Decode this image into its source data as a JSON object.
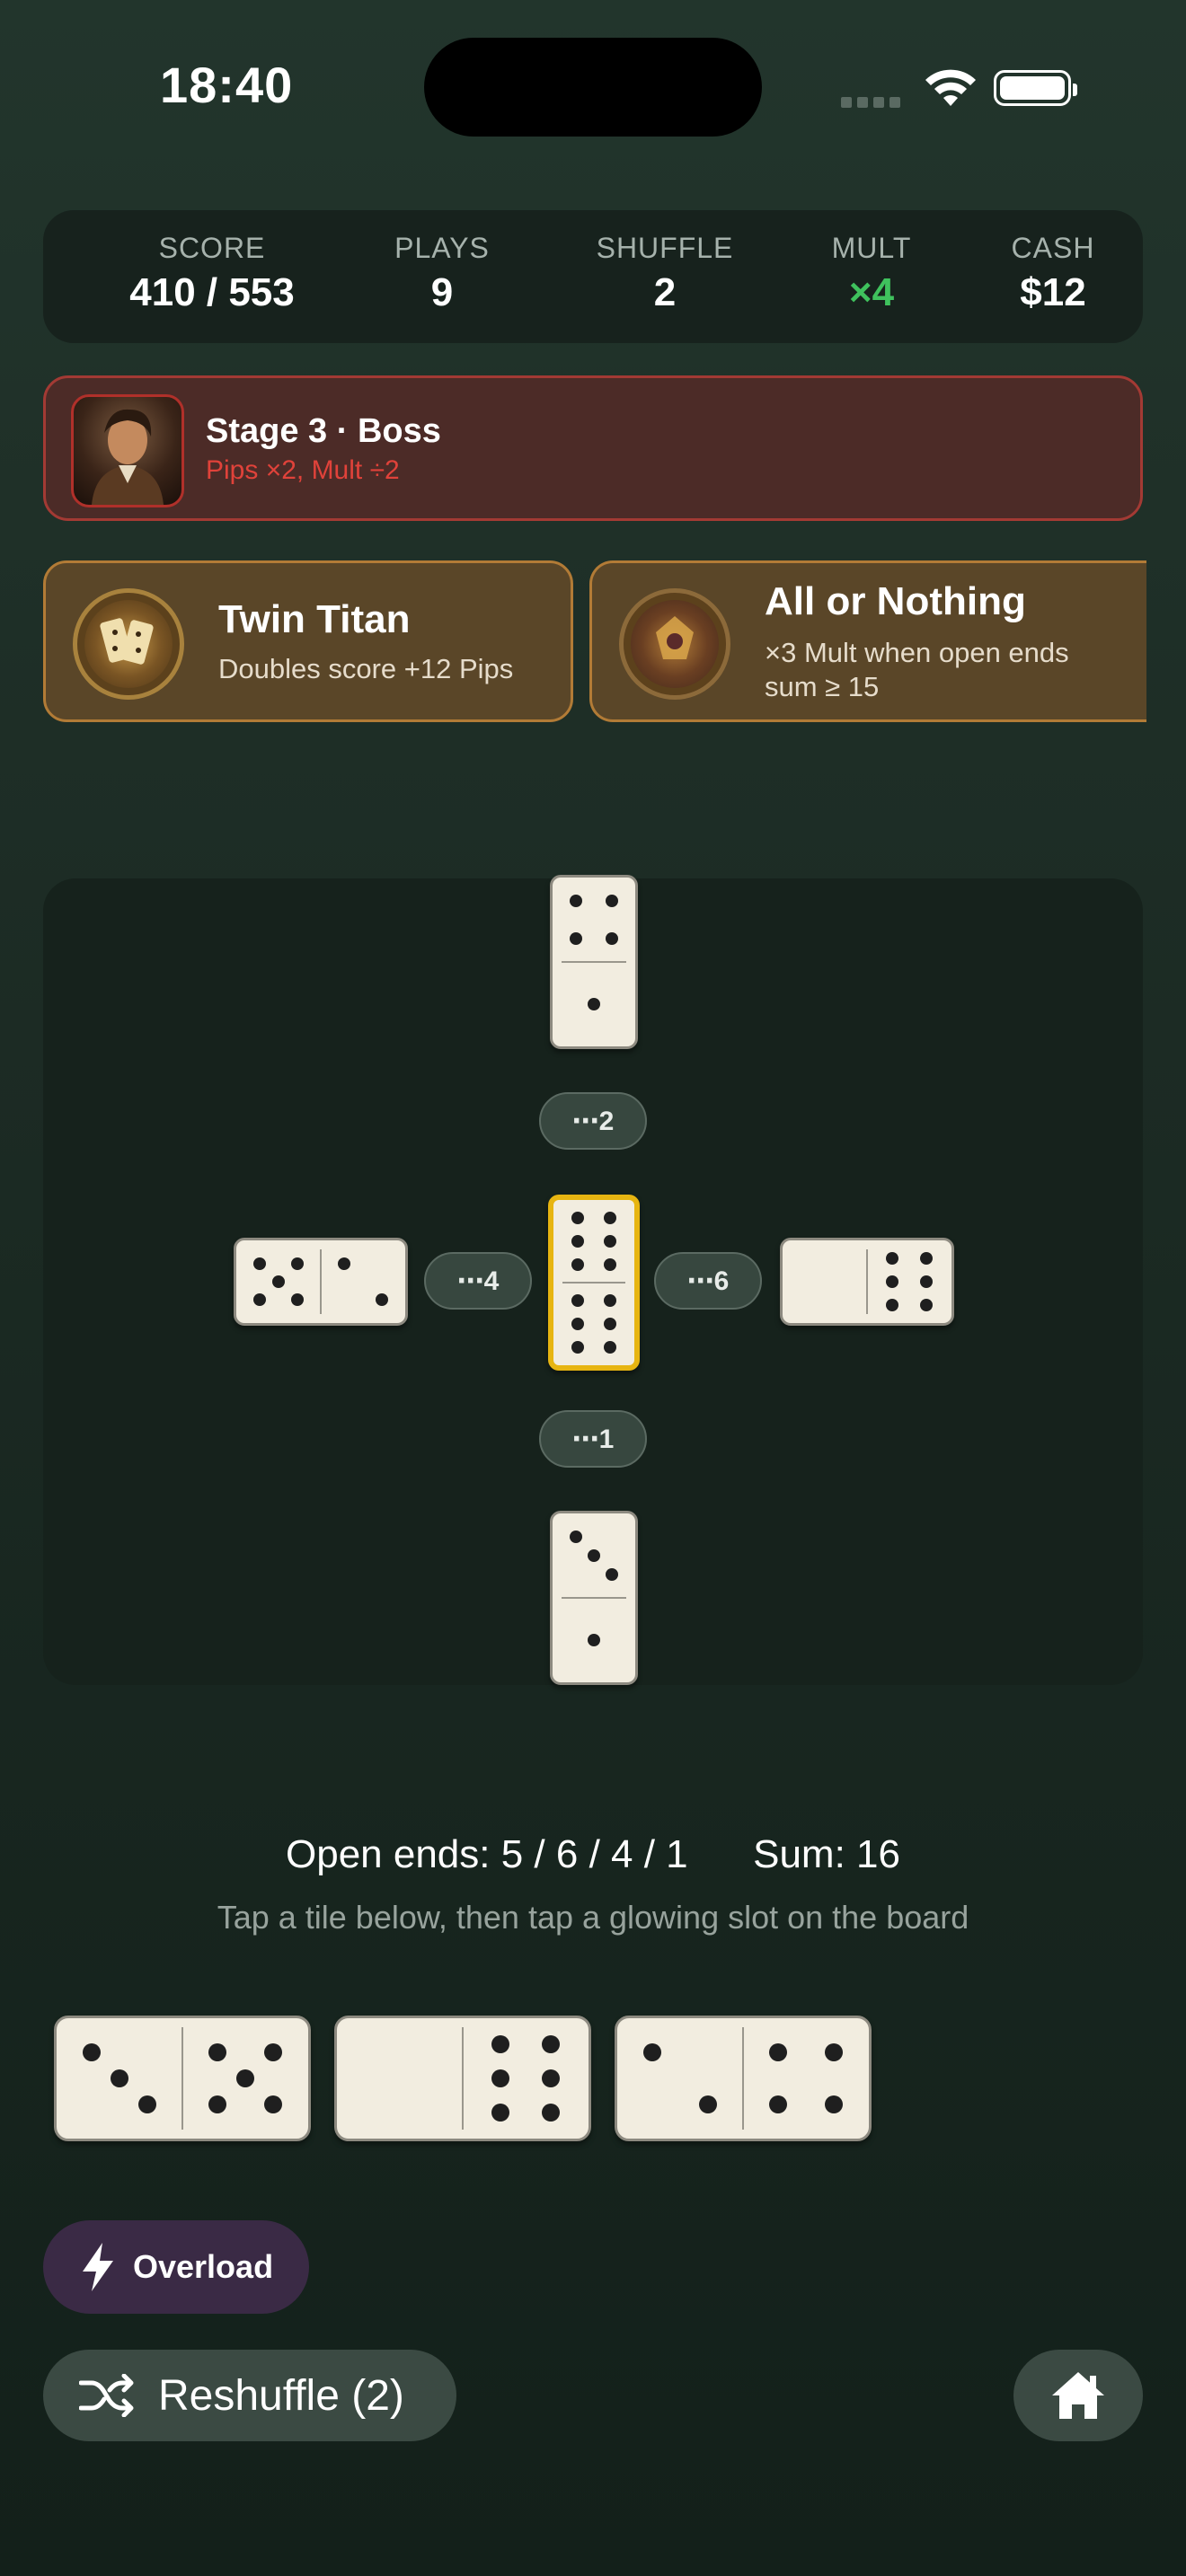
{
  "status_bar": {
    "time": "18:40"
  },
  "stats": [
    {
      "label": "SCORE",
      "value": "410 / 553"
    },
    {
      "label": "PLAYS",
      "value": "9"
    },
    {
      "label": "SHUFFLE",
      "value": "2"
    },
    {
      "label": "MULT",
      "value": "×4"
    },
    {
      "label": "CASH",
      "value": "$12"
    }
  ],
  "boss": {
    "title": "Stage 3 · Boss",
    "effect": "Pips ×2, Mult ÷2"
  },
  "jokers": [
    {
      "name": "Twin Titan",
      "desc_line1": "Doubles score +12 Pips",
      "desc_line2": ""
    },
    {
      "name": "All or Nothing",
      "desc_line1": "×3 Mult when open ends",
      "desc_line2": "sum ≥ 15"
    }
  ],
  "board": {
    "slots": {
      "top": "⋯2",
      "left": "⋯4",
      "right": "⋯6",
      "bottom": "⋯1"
    },
    "tiles": {
      "top": [
        4,
        1
      ],
      "center": [
        6,
        6
      ],
      "left": [
        5,
        2
      ],
      "right": [
        0,
        6
      ],
      "bottom": [
        3,
        1
      ]
    }
  },
  "info": {
    "open_ends": "Open ends: 5 / 6 / 4 / 1",
    "sum": "Sum: 16",
    "hint": "Tap a tile below, then tap a glowing slot on the board"
  },
  "hand": [
    [
      3,
      5
    ],
    [
      0,
      6
    ],
    [
      2,
      4
    ]
  ],
  "buttons": {
    "overload": "Overload",
    "reshuffle": "Reshuffle (2)"
  },
  "icons": {
    "overload": "lightning-icon",
    "reshuffle": "shuffle-icon",
    "home": "home-icon"
  },
  "colors": {
    "mult": "#3fc25d",
    "boss_border": "#a33a34",
    "boss_effect": "#e0423a",
    "selected_tile": "#e7b511"
  }
}
